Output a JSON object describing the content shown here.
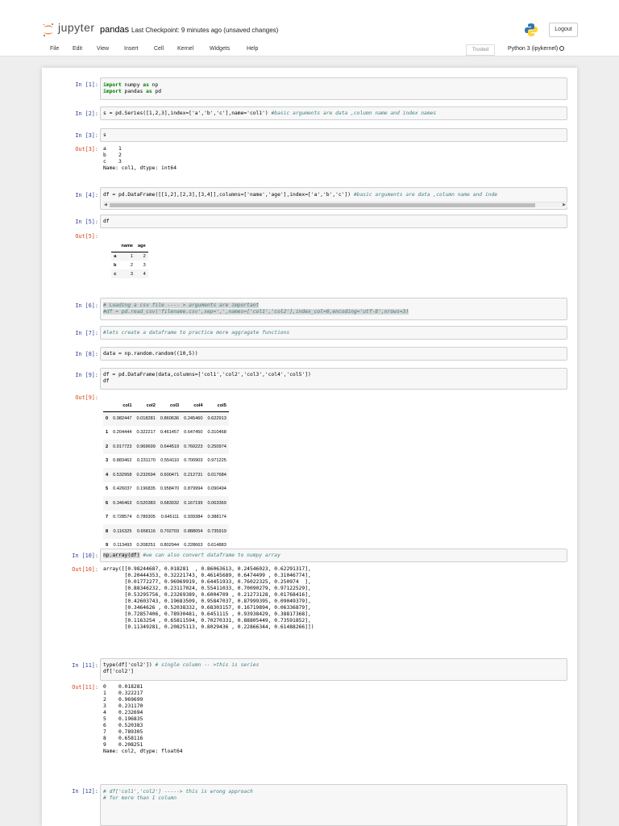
{
  "header": {
    "logo_text": "jupyter",
    "notebook_name": "pandas",
    "checkpoint": "Last Checkpoint: 9 minutes ago  (unsaved changes)",
    "logout": "Logout"
  },
  "menu": {
    "items": [
      "File",
      "Edit",
      "View",
      "Insert",
      "Cell",
      "Kernel",
      "Widgets",
      "Help"
    ],
    "trusted": "Trusted",
    "kernel": "Python 3 (ipykernel)"
  },
  "cells": {
    "p1": "In [1]:",
    "p2": "In [2]:",
    "p3": "In [3]:",
    "o3": "Out[3]:",
    "p4": "In [4]:",
    "p5": "In [5]:",
    "o5": "Out[5]:",
    "p6": "In [6]:",
    "p7": "In [7]:",
    "p8": "In [8]:",
    "p9": "In [9]:",
    "o9": "Out[9]:",
    "p10": "In [10]:",
    "o10": "Out[10]:",
    "p11": "In [11]:",
    "o11": "Out[11]:",
    "p12": "In [12]:",
    "c1_l1_kw": "import",
    "c1_l1_a": " numpy ",
    "c1_l1_kw2": "as",
    "c1_l1_b": " np",
    "c1_l2_kw": "import",
    "c1_l2_a": " pandas ",
    "c1_l2_kw2": "as",
    "c1_l2_b": " pd",
    "c2_code": "s = pd.Series([1,2,3],index=['a','b','c'],name='col1')",
    "c2_comment": " #basic arguments are data ,column name and index names",
    "c3_code": "s",
    "c3_out": "a    1\nb    2\nc    3\nName: col1, dtype: int64",
    "c4_code": "df = pd.DataFrame([[1,2],[2,3],[3,4]],columns=['name','age'],index=['a','b','c'])",
    "c4_comment": " #basic arguments are data ,column name and inde",
    "c5_code": "df",
    "c6_l1": "# Loading a csv file ---- > arguments are important",
    "c6_l2": "#df = pd.read_csv('filename.csv',sep=',',names=['col1','col2'],index_col=0,encoding='utf-8',nrows=3)",
    "c7_code": "#lets create a dataframe to practice more aggragate functions",
    "c8_code": "data = np.random.random((10,5))",
    "c9_l1": "df = pd.DataFrame(data,columns=['col1','col2','col3','col4','col5'])",
    "c9_l2": "df",
    "c10_code": "np.array(df)",
    "c10_comment": " #we can also convert dataframe to numpy array",
    "c10_out": "array([[0.98244687, 0.018281  , 0.86063613, 0.24546023, 0.62291317],\n       [0.20444353, 0.32221743, 0.46145689, 0.6474499 , 0.31046774],\n       [0.01772277, 0.96969919, 0.64451933, 0.76022325, 0.250974  ],\n       [0.88346232, 0.23117024, 0.55411033, 0.70090279, 0.97122529],\n       [0.53295756, 0.23269389, 0.6004709 , 0.21273128, 0.01768416],\n       [0.42603743, 0.19683509, 0.95847037, 0.87999395, 0.09049379],\n       [0.3464626 , 0.52038332, 0.68303157, 0.16719894, 0.06336879],\n       [0.72857406, 0.78930481, 0.6451115 , 0.93938429, 0.38817368],\n       [0.1163254 , 0.65811594, 0.70270331, 0.88805449, 0.73591852],\n       [0.11349281, 0.20825113, 0.8029436 , 0.22866344, 0.61488266]])",
    "c11_l1": "type(df['col2'])",
    "c11_comment": " # single column -- >this is series",
    "c11_l2": "df['col2']",
    "c11_out": "0    0.018281\n1    0.322217\n2    0.969699\n3    0.231170\n4    0.232694\n5    0.196835\n6    0.520383\n7    0.789305\n8    0.658116\n9    0.208251\nName: col2, dtype: float64",
    "c12_l1": "# df['col1','col2'] -----> this is wrong approach",
    "c12_l2": "# for more than 1 column"
  },
  "df1": {
    "columns": [
      "name",
      "age"
    ],
    "rows": [
      {
        "index": "a",
        "values": [
          "1",
          "2"
        ]
      },
      {
        "index": "b",
        "values": [
          "2",
          "3"
        ]
      },
      {
        "index": "c",
        "values": [
          "3",
          "4"
        ]
      }
    ]
  },
  "df2": {
    "columns": [
      "col1",
      "col2",
      "col3",
      "col4",
      "col5"
    ],
    "rows": [
      {
        "index": "0",
        "values": [
          "0.982447",
          "0.018281",
          "0.860636",
          "0.245460",
          "0.622913"
        ]
      },
      {
        "index": "1",
        "values": [
          "0.204444",
          "0.322217",
          "0.461457",
          "0.647450",
          "0.310468"
        ]
      },
      {
        "index": "2",
        "values": [
          "0.017723",
          "0.969699",
          "0.644519",
          "0.760223",
          "0.250974"
        ]
      },
      {
        "index": "3",
        "values": [
          "0.883462",
          "0.231170",
          "0.554110",
          "0.700903",
          "0.971225"
        ]
      },
      {
        "index": "4",
        "values": [
          "0.532958",
          "0.232694",
          "0.600471",
          "0.212731",
          "0.017684"
        ]
      },
      {
        "index": "5",
        "values": [
          "0.426037",
          "0.196835",
          "0.958470",
          "0.879994",
          "0.090494"
        ]
      },
      {
        "index": "6",
        "values": [
          "0.346463",
          "0.520383",
          "0.683032",
          "0.167199",
          "0.063369"
        ]
      },
      {
        "index": "7",
        "values": [
          "0.728574",
          "0.789305",
          "0.645111",
          "0.939384",
          "0.388174"
        ]
      },
      {
        "index": "8",
        "values": [
          "0.116325",
          "0.658116",
          "0.702703",
          "0.888054",
          "0.735919"
        ]
      },
      {
        "index": "9",
        "values": [
          "0.113493",
          "0.208251",
          "0.802944",
          "0.228663",
          "0.614883"
        ]
      }
    ]
  },
  "colors": {
    "in_prompt": "#303f9f",
    "out_prompt": "#d84315",
    "keyword": "#008000",
    "string": "#ba2121",
    "comment": "#408080"
  }
}
